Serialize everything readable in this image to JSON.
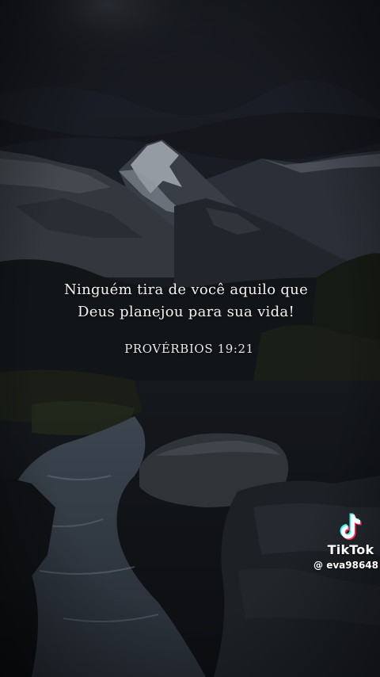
{
  "quote": {
    "line1": "Ninguém tira de você aquilo que",
    "line2": "Deus planejou para sua vida!"
  },
  "reference": "PROVÉRBIOS 19:21",
  "watermark": {
    "brand": "TikTok",
    "handle": "@ eva98648",
    "icon": "tiktok-note-icon"
  },
  "colors": {
    "text": "#f2f2f2",
    "tiktok_cyan": "#25F4EE",
    "tiktok_red": "#FE2C55"
  }
}
